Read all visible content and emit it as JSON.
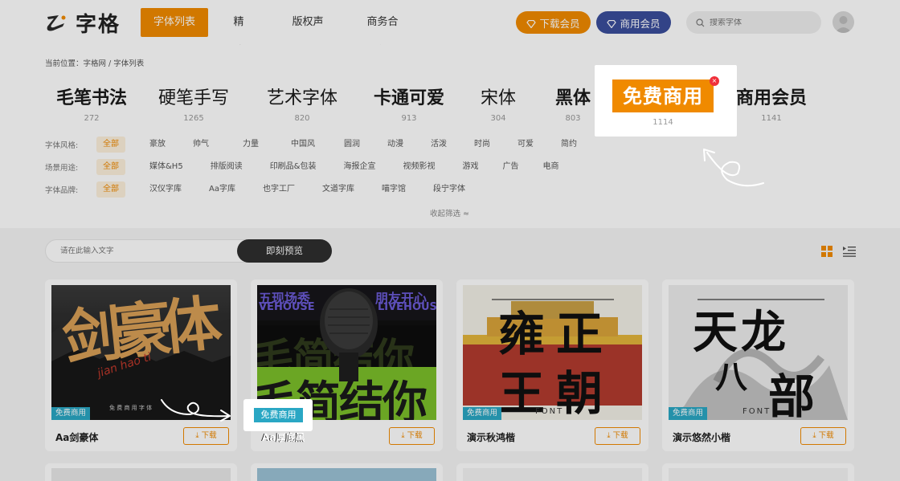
{
  "header": {
    "logo_text": "字格",
    "nav": [
      "字体列表",
      "精选",
      "版权声明",
      "商务合作"
    ],
    "download_vip": "下载会员",
    "business_vip": "商用会员",
    "search_placeholder": "搜索字体"
  },
  "breadcrumb": "当前位置：字格网 / 字体列表",
  "categories": [
    {
      "name": "毛笔书法",
      "count": "272"
    },
    {
      "name": "硬笔手写",
      "count": "1265"
    },
    {
      "name": "艺术字体",
      "count": "820"
    },
    {
      "name": "卡通可爱",
      "count": "913"
    },
    {
      "name": "宋体",
      "count": "304"
    },
    {
      "name": "黑体",
      "count": "803"
    },
    {
      "name": "免费商用",
      "count": "1114"
    },
    {
      "name": "商用会员",
      "count": "1141"
    }
  ],
  "filters": {
    "style": {
      "label": "字体风格:",
      "options": [
        "全部",
        "豪放",
        "帅气",
        "力量",
        "中国风",
        "圆润",
        "动漫",
        "活泼",
        "时尚",
        "可爱",
        "简约"
      ]
    },
    "scene": {
      "label": "场景用途:",
      "options": [
        "全部",
        "媒体&H5",
        "排版阅读",
        "印刷品&包装",
        "海报企宣",
        "视频影视",
        "游戏",
        "广告",
        "电商"
      ]
    },
    "brand": {
      "label": "字体品牌:",
      "options": [
        "全部",
        "汉仪字库",
        "Aa字库",
        "也字工厂",
        "文道字库",
        "喵字馆",
        "段宁字体"
      ]
    },
    "collapse": "收起筛选 ≈"
  },
  "popup": {
    "badge": "免费商用",
    "count": "1114",
    "close": "×"
  },
  "preview": {
    "placeholder": "请在此输入文字",
    "button": "即刻预览"
  },
  "cards": [
    {
      "title": "Aa剑豪体",
      "tag": "免费商用",
      "download": "⤓  下载",
      "art": "剑豪体",
      "art_sub": "jian hao ti",
      "art_small": "免 费 商 用 字 体"
    },
    {
      "title": "Aa厚底黑",
      "tag": "免费商用",
      "download": "⤓  下载",
      "art_top_left": "五现场秀",
      "art_top_right": "朋友开心",
      "art_sub": "VEHOUSE",
      "art_sub2": "LIVEHOUS",
      "art_mid": "毛简结你",
      "art_bottom": "毛简结你"
    },
    {
      "title": "演示秋鸿楷",
      "tag": "免费商用",
      "download": "⤓  下载",
      "art_top": "雍正",
      "art_bottom": "王朝",
      "art_font": "FONT"
    },
    {
      "title": "演示悠然小楷",
      "tag": "免费商用",
      "download": "⤓  下载",
      "art_top": "天龙",
      "art_mid": "八",
      "art_bottom": "部",
      "art_font": "FONT"
    }
  ],
  "highlight_tag": "免费商用",
  "colors": {
    "accent": "#f08a00",
    "vip": "#3a4d9c",
    "tag": "#2aa7c4"
  }
}
